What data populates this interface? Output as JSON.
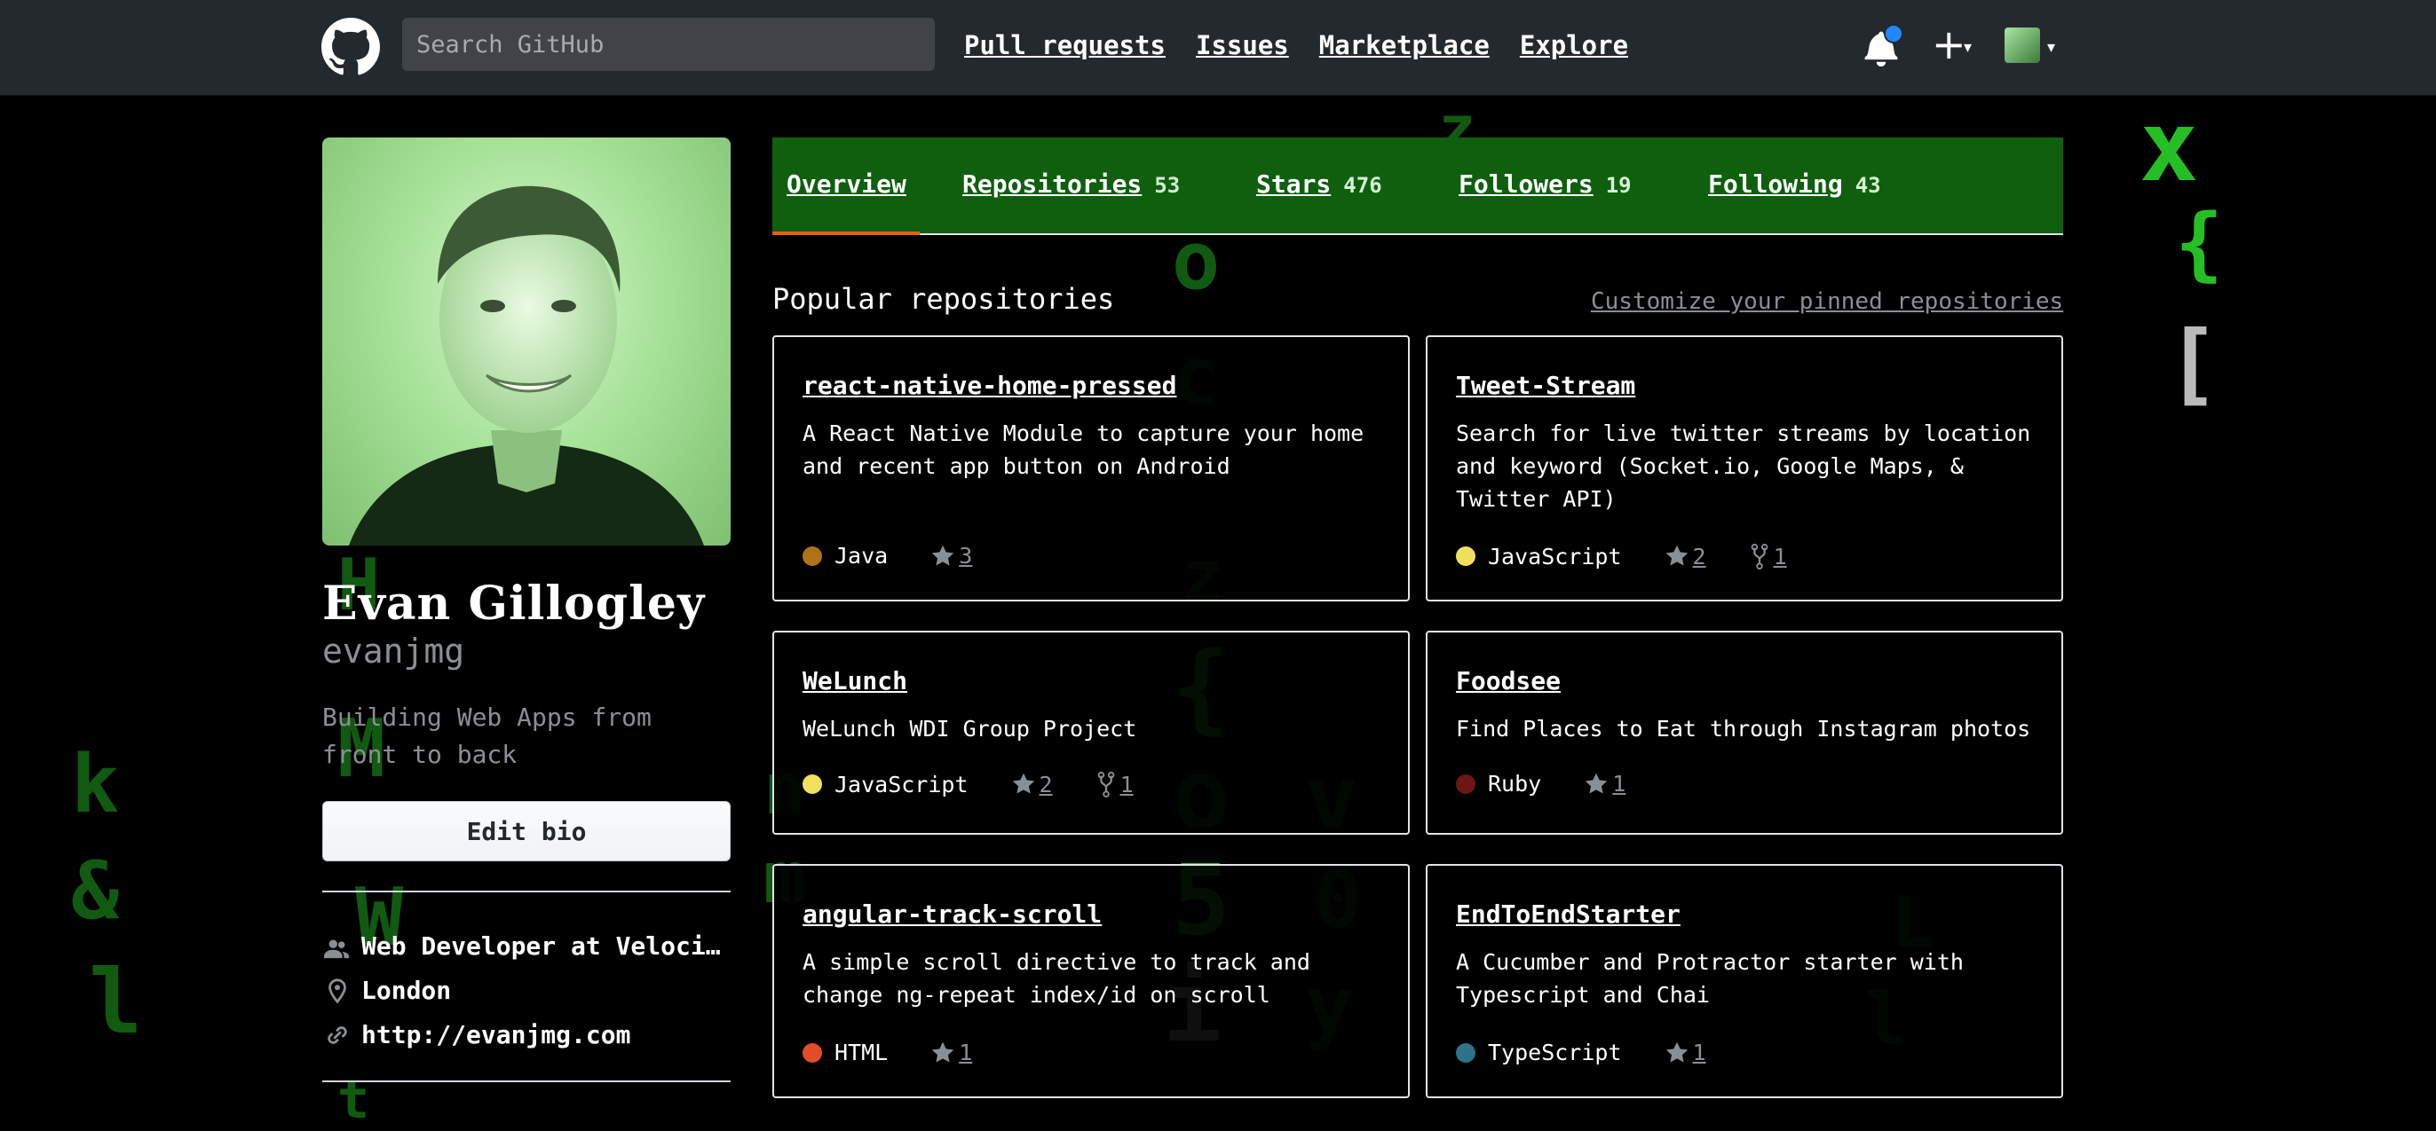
{
  "header": {
    "search_placeholder": "Search GitHub",
    "nav": [
      "Pull requests",
      "Issues",
      "Marketplace",
      "Explore"
    ],
    "has_notification": true
  },
  "profile": {
    "fullname": "Evan Gillogley",
    "username": "evanjmg",
    "bio": "Building Web Apps from front to back",
    "edit_bio_label": "Edit bio",
    "company": "Web Developer at Veloci…",
    "location": "London",
    "website": "http://evanjmg.com"
  },
  "tabs": [
    {
      "label": "Overview",
      "count": ""
    },
    {
      "label": "Repositories",
      "count": "53"
    },
    {
      "label": "Stars",
      "count": "476"
    },
    {
      "label": "Followers",
      "count": "19"
    },
    {
      "label": "Following",
      "count": "43"
    }
  ],
  "pinned": {
    "title": "Popular repositories",
    "customize_label": "Customize your pinned repositories",
    "repos": [
      {
        "name": "react-native-home-pressed",
        "description": "A React Native Module to capture your home and recent app button on Android",
        "language": "Java",
        "language_color": "#b07219",
        "stars": "3",
        "forks": ""
      },
      {
        "name": "Tweet-Stream",
        "description": "Search for live twitter streams by location and keyword (Socket.io, Google Maps, & Twitter API)",
        "language": "JavaScript",
        "language_color": "#f1e05a",
        "stars": "2",
        "forks": "1"
      },
      {
        "name": "WeLunch",
        "description": "WeLunch WDI Group Project",
        "language": "JavaScript",
        "language_color": "#f1e05a",
        "stars": "2",
        "forks": "1"
      },
      {
        "name": "Foodsee",
        "description": "Find Places to Eat through Instagram photos",
        "language": "Ruby",
        "language_color": "#701516",
        "stars": "1",
        "forks": ""
      },
      {
        "name": "angular-track-scroll",
        "description": "A simple scroll directive to track and change ng-repeat index/id on scroll",
        "language": "HTML",
        "language_color": "#e34c26",
        "stars": "1",
        "forks": ""
      },
      {
        "name": "EndToEndStarter",
        "description": "A Cucumber and Protractor starter with Typescript and Chai",
        "language": "TypeScript",
        "language_color": "#2b7489",
        "stars": "1",
        "forks": ""
      }
    ]
  },
  "icons": {
    "logo": "github-mark-icon",
    "notifications": "bell-icon",
    "new": "plus-icon",
    "company": "people-icon",
    "location": "location-pin-icon",
    "website": "link-icon",
    "stars": "star-icon",
    "forks": "fork-icon"
  },
  "colors": {
    "header_bg": "#24292e",
    "tabs_bg": "#0f5f0f",
    "tab_active_underline": "#e36209",
    "notification_dot": "#2188ff"
  }
}
